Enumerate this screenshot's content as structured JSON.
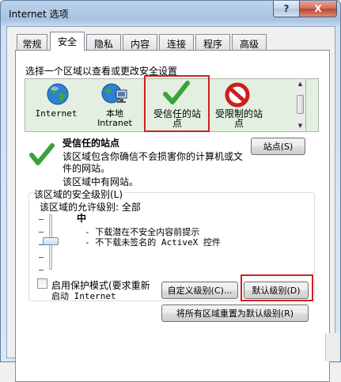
{
  "window": {
    "title": "Internet 选项",
    "help_label": "?",
    "close_label": "X"
  },
  "tabs": [
    "常规",
    "安全",
    "隐私",
    "内容",
    "连接",
    "程序",
    "高级"
  ],
  "security": {
    "select_zone_label": "选择一个区域以查看或更改安全设置",
    "zones": [
      {
        "icon": "globe-icon",
        "label": "Internet"
      },
      {
        "icon": "local-intranet-icon",
        "label": "本地\nIntranet"
      },
      {
        "icon": "checkmark-icon",
        "label": "受信任的站\n点"
      },
      {
        "icon": "restricted-icon",
        "label": "受限制的站\n点"
      }
    ],
    "zone_title": "受信任的站点",
    "zone_desc_1": "该区域包含你确信不会损害你的计算机或文",
    "zone_desc_2": "件的网站。",
    "zone_desc_3": "该区域中有网站。",
    "sites_button": "站点(S)",
    "security_level_group": "该区域的安全级别(L)",
    "allowed_levels": "该区域的允许级别: 全部",
    "level_name": "中",
    "level_desc_1": "- 下载潜在不安全内容前提示",
    "level_desc_2": "- 不下载未签名的 ActiveX 控件",
    "protected_mode_label_1": "启用保护模式(要求重新",
    "protected_mode_label_2": "启动 Internet",
    "protected_mode_checked": false,
    "custom_level_button": "自定义级别(C)...",
    "default_level_button": "默认级别(D)",
    "reset_all_button": "将所有区域重置为默认级别(R)"
  },
  "colors": {
    "highlight_frame": "#d21f1f",
    "zone_background": "#e3efe0"
  }
}
